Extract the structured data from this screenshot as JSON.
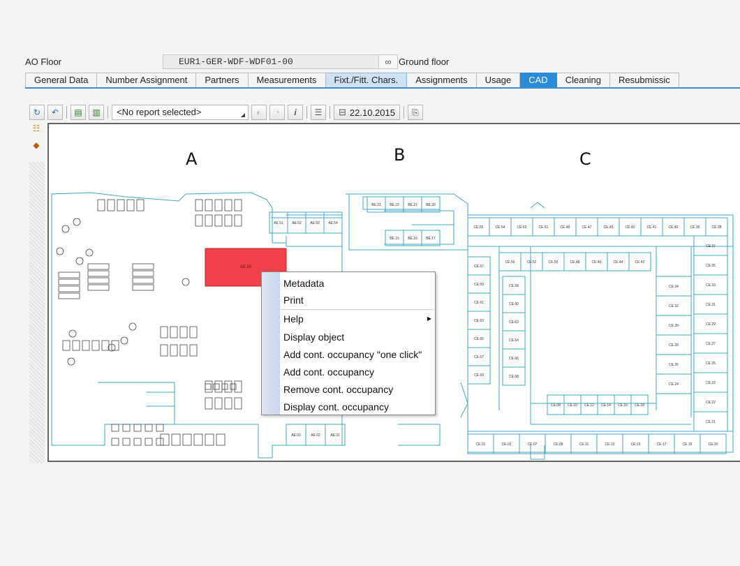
{
  "header": {
    "label": "AO Floor",
    "code": "EUR1-GER-WDF-WDF01-00",
    "description": "Ground floor"
  },
  "tabs": [
    {
      "label": "General Data",
      "state": "normal"
    },
    {
      "label": "Number Assignment",
      "state": "normal"
    },
    {
      "label": "Partners",
      "state": "normal"
    },
    {
      "label": "Measurements",
      "state": "normal"
    },
    {
      "label": "Fixt./Fitt. Chars.",
      "state": "hover"
    },
    {
      "label": "Assignments",
      "state": "normal"
    },
    {
      "label": "Usage",
      "state": "normal"
    },
    {
      "label": "CAD",
      "state": "active"
    },
    {
      "label": "Cleaning",
      "state": "normal"
    },
    {
      "label": "Resubmissic",
      "state": "normal"
    }
  ],
  "toolbar": {
    "report_placeholder": "<No report selected>",
    "date": "22.10.2015"
  },
  "floorplan": {
    "section_a": "A",
    "section_b": "B",
    "section_c": "C",
    "highlighted_room": "AE.50",
    "highlight_color": "#f2414b",
    "line_color": "#3fa7c9",
    "rooms_b_top": [
      "BE.23",
      "BE.22",
      "BE.21",
      "BE.20"
    ],
    "rooms_b_mid": [
      "BE.15",
      "BE.16",
      "BE.17"
    ],
    "rooms_c_top": [
      "CE.55",
      "CE.54",
      "CE.53",
      "CE.51",
      "CE.49",
      "CE.47",
      "CE.45",
      "CE.43",
      "CE.41",
      "CE.40",
      "CE.39",
      "CE.38"
    ],
    "rooms_c_inner_top": [
      "CE.56",
      "CE.52",
      "CE.50",
      "CE.48",
      "CE.46",
      "CE.44",
      "CE.42"
    ],
    "rooms_c_left": [
      "CE.57",
      "CE.59",
      "CE.61",
      "CE.63",
      "CE.65",
      "CE.67",
      "CE.69"
    ],
    "rooms_c_left2": [
      "CE.58",
      "CE.60",
      "CE.62",
      "CE.64",
      "CE.66",
      "CE.68"
    ],
    "rooms_c_right": [
      "CE.34",
      "CE.32",
      "CE.30",
      "CE.28",
      "CE.26",
      "CE.24"
    ],
    "rooms_c_right2": [
      "CE.37",
      "CE.35",
      "CE.33",
      "CE.31",
      "CE.29",
      "CE.27",
      "CE.25",
      "CE.23",
      "CE.22",
      "CE.21"
    ],
    "rooms_c_inner_bottom": [
      "CE.08",
      "CE.10",
      "CE.12",
      "CE.14",
      "CE.16",
      "CE.18"
    ],
    "rooms_c_bottom": [
      "CE.01",
      "CE.03",
      "CE.07",
      "CE.09",
      "CE.11",
      "CE.13",
      "CE.15",
      "CE.17",
      "CE.19",
      "CE.20"
    ],
    "rooms_a_top": [
      "AE.51",
      "AE.52",
      "AE.53",
      "AE.54"
    ],
    "rooms_a_bottom": [
      "AE.03",
      "AE.02",
      "AE.01"
    ]
  },
  "context_menu": {
    "items": [
      {
        "label": "Metadata"
      },
      {
        "label": "Print"
      },
      {
        "label": "Help",
        "submenu": true
      },
      {
        "label": "Display object"
      },
      {
        "label": "Add cont. occupancy \"one click\""
      },
      {
        "label": "Add cont. occupancy"
      },
      {
        "label": "Remove cont. occupancy"
      },
      {
        "label": "Display cont. occupancy"
      }
    ]
  }
}
